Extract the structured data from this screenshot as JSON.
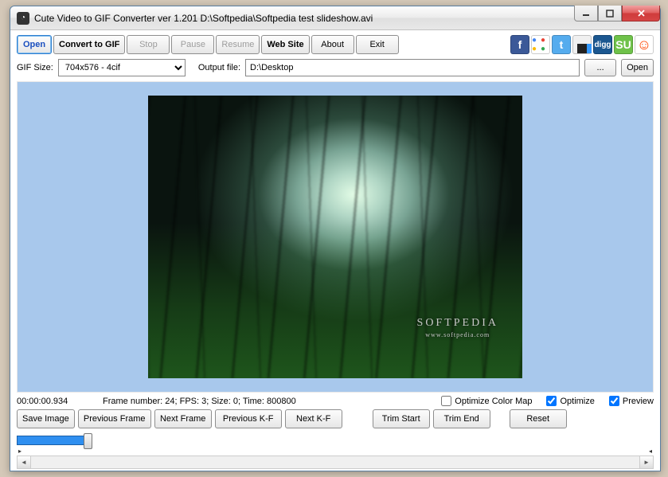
{
  "title": "Cute Video to GIF Converter ver 1.201   D:\\Softpedia\\Softpedia test slideshow.avi",
  "toolbar": {
    "open": "Open",
    "convert": "Convert to GIF",
    "stop": "Stop",
    "pause": "Pause",
    "resume": "Resume",
    "website": "Web Site",
    "about": "About",
    "exit": "Exit"
  },
  "row2": {
    "gif_size_label": "GIF Size:",
    "gif_size_value": "704x576 - 4cif",
    "output_label": "Output file:",
    "output_value": "D:\\Desktop",
    "browse": "...",
    "open": "Open"
  },
  "preview": {
    "watermark": "SOFTPEDIA",
    "watermark_sub": "www.softpedia.com"
  },
  "status": {
    "time": "00:00:00.934",
    "info": "Frame number: 24; FPS: 3; Size: 0; Time: 800800",
    "optimize_color_map": "Optimize Color Map",
    "optimize_color_map_checked": false,
    "optimize": "Optimize",
    "optimize_checked": true,
    "preview": "Preview",
    "preview_checked": true
  },
  "bottom": {
    "save_image": "Save Image",
    "prev_frame": "Previous Frame",
    "next_frame": "Next Frame",
    "prev_kf": "Previous K-F",
    "next_kf": "Next K-F",
    "trim_start": "Trim Start",
    "trim_end": "Trim End",
    "reset": "Reset"
  },
  "social_icons": [
    "facebook",
    "google",
    "twitter",
    "delicious",
    "digg",
    "stumbleupon",
    "reddit"
  ]
}
